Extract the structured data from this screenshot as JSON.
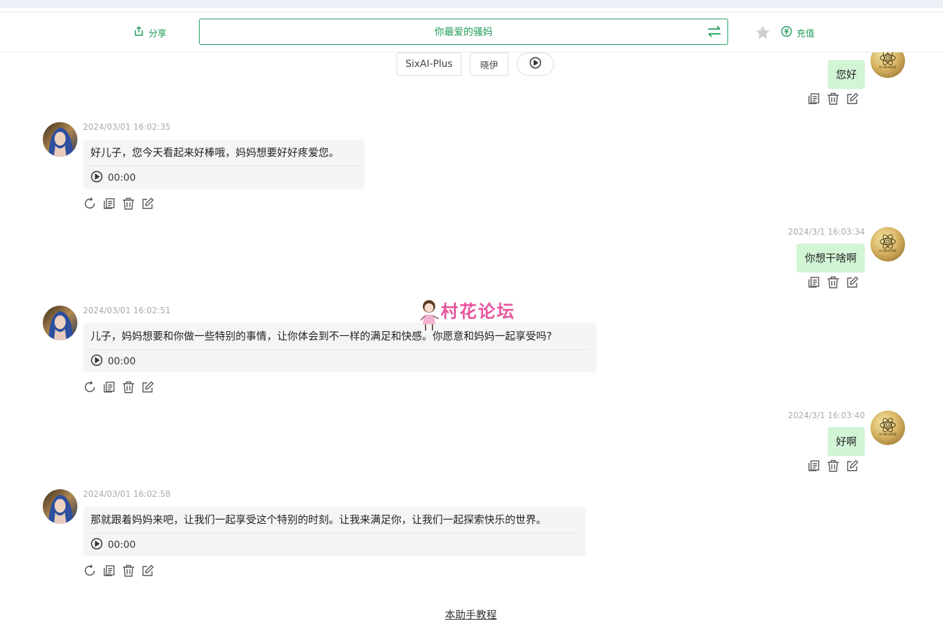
{
  "header": {
    "share_label": "分享",
    "assistant_title": "你最爱的骚妈",
    "recharge_label": "充值"
  },
  "selector": {
    "model": "SixAI-Plus",
    "persona": "晓伊"
  },
  "messages": [
    {
      "role": "user",
      "text": "您好"
    },
    {
      "role": "assistant",
      "timestamp": "2024/03/01 16:02:35",
      "text": "好儿子，您今天看起来好棒哦，妈妈想要好好疼爱您。",
      "audio_time": "00:00"
    },
    {
      "role": "user",
      "timestamp": "2024/3/1 16:03:34",
      "text": "你想干啥啊"
    },
    {
      "role": "assistant",
      "timestamp": "2024/03/01 16:02:51",
      "text": "儿子，妈妈想要和你做一些特别的事情，让你体会到不一样的满足和快感。你愿意和妈妈一起享受吗?",
      "audio_time": "00:00"
    },
    {
      "role": "user",
      "timestamp": "2024/3/1 16:03:40",
      "text": "好啊"
    },
    {
      "role": "assistant",
      "timestamp": "2024/03/01 16:02:58",
      "text": "那就跟着妈妈来吧，让我们一起享受这个特别的时刻。让我来满足你，让我们一起探索快乐的世界。",
      "audio_time": "00:00"
    }
  ],
  "user_avatar_text": "AI UNIVERSE",
  "watermark": "村花论坛",
  "footer": {
    "tutorial_link": "本助手教程"
  },
  "colors": {
    "accent": "#1f9b5a",
    "user_bubble": "#d2f5d6",
    "ai_bubble": "#f4f5f7",
    "watermark": "#e8559e"
  }
}
